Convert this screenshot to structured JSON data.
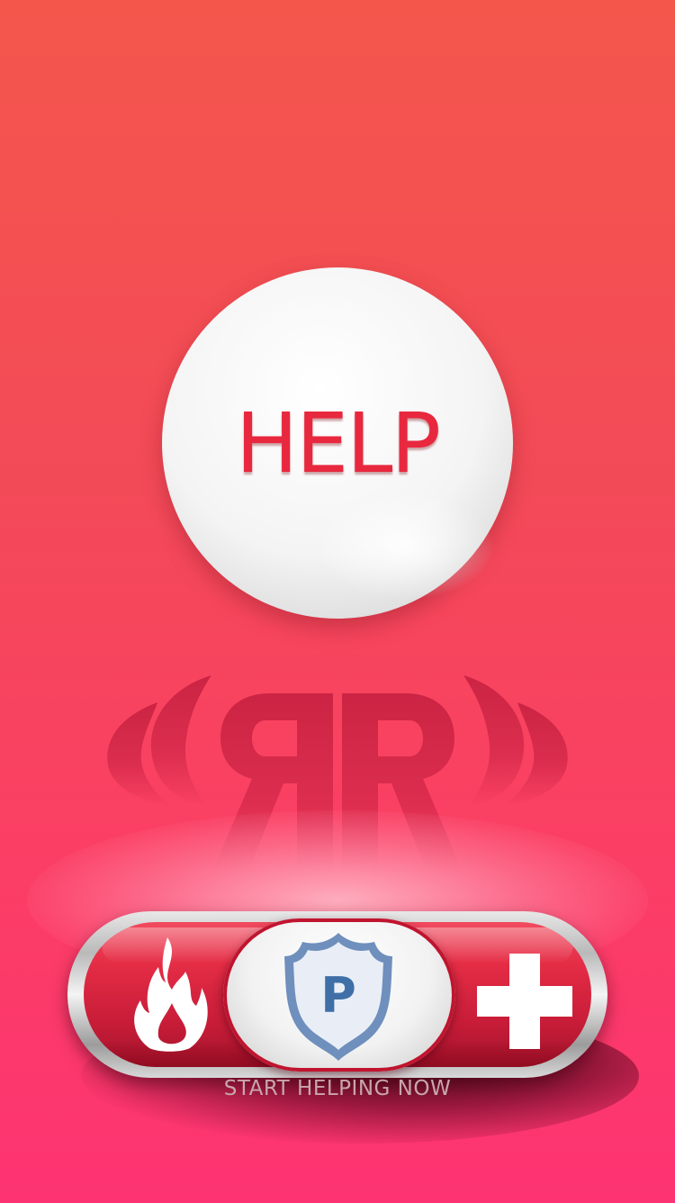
{
  "help_button": {
    "label": "HELP"
  },
  "logo": {
    "letters": "RR"
  },
  "slider": {
    "left_icon": "fire-icon",
    "center_icon": "police-badge-icon",
    "center_letter": "P",
    "right_icon": "medical-cross-icon",
    "hint": "START HELPING NOW"
  },
  "colors": {
    "accent": "#e8283e",
    "badge_blue": "#3f6fa6",
    "background_top": "#f4564c",
    "background_bottom": "#fd3372"
  }
}
